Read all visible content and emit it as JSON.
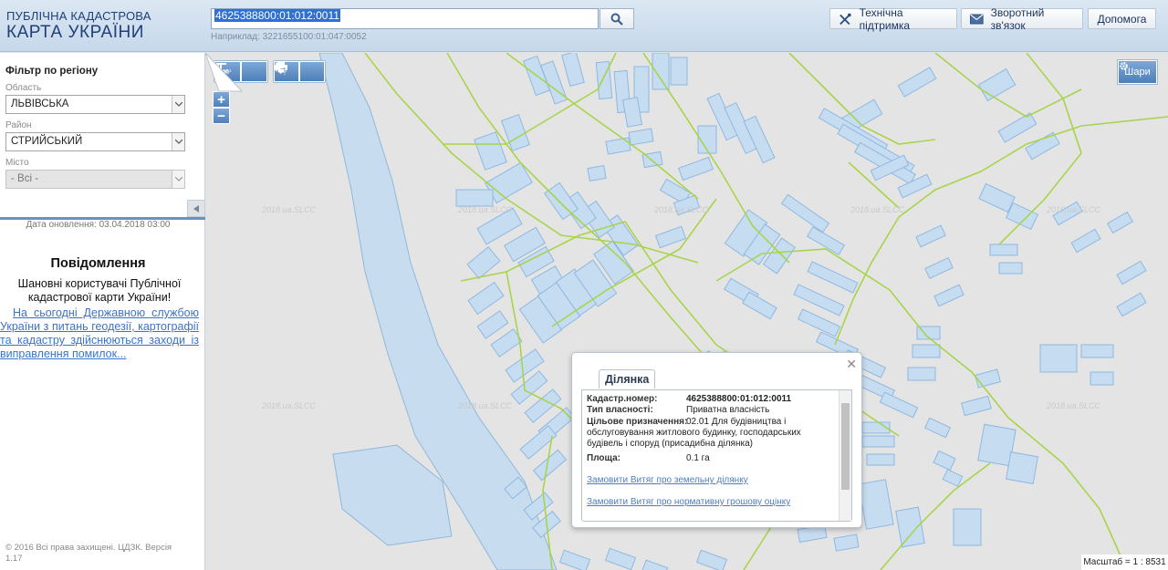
{
  "header": {
    "logo_line1": "ПУБЛІЧНА КАДАСТРОВА",
    "logo_line2": "КАРТА УКРАЇНИ",
    "search_value": "4625388800:01:012:0011",
    "search_hint": "Наприклад: 3221655100:01:047:0052",
    "support_label": "Технічна підтримка",
    "feedback_label": "Зворотний зв'язок",
    "help_label": "Допомога"
  },
  "sidebar": {
    "filter_title": "Фільтр по регіону",
    "region_label": "Область",
    "region_value": "ЛЬВІВСЬКА",
    "district_label": "Район",
    "district_value": "СТРИЙСЬКИЙ",
    "city_label": "Місто",
    "city_value": "- Всі -",
    "update_date": "Дата оновлення: 03.04.2018 03:00",
    "notice_title": "Повідомлення",
    "notice_text": "Шановні користувачі Публічної кадастрової карти України!",
    "notice_link": "На сьогодні Державною службою України з питань геодезії, картографії та кадастру здійснюються заходи із виправлення помилок...",
    "copyright": "© 2016 Всі права захищені. ЦДЗК. Версія 1.17"
  },
  "map": {
    "layers_label": "Шари",
    "scale": "Масштаб = 1 : 8531",
    "watermark": "2018.ua.SLCC"
  },
  "popup": {
    "tab": "Ділянка",
    "cadastral_label": "Кадастр.номер:",
    "cadastral_value": "4625388800:01:012:0011",
    "ownership_label": "Тип власності:",
    "ownership_value": "Приватна власність",
    "purpose_label": "Цільове призначення:",
    "purpose_value": "02.01 Для будівництва і обслуговування житлового будинку, господарських будівель і споруд (присадибна ділянка)",
    "area_label": "Площа:",
    "area_value": "0.1 га",
    "link1": "Замовити Витяг про земельну ділянку",
    "link2": "Замовити Витяг про нормативну грошову оцінку"
  },
  "colors": {
    "parcel_fill": "#c6dcf0",
    "parcel_stroke": "#8fb8e0",
    "boundary": "#a8d44a",
    "header_text": "#1f3f78"
  }
}
